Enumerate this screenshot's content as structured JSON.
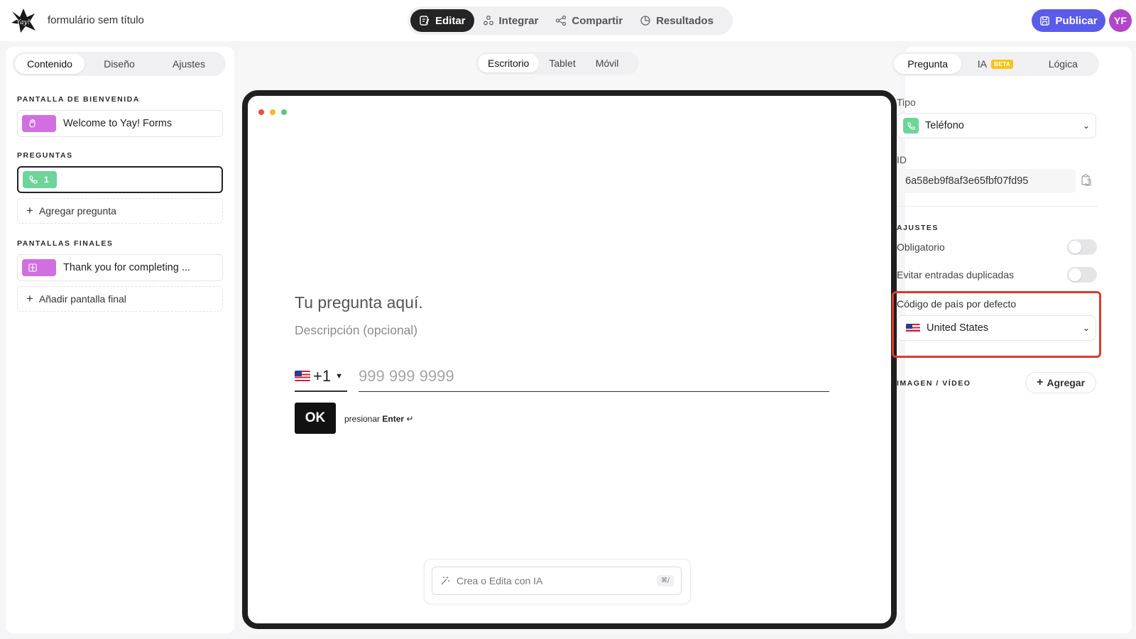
{
  "app": {
    "form_title": "formulário sem título",
    "avatar_initials": "YF",
    "publish_label": "Publicar",
    "accent_color": "#5b5bea"
  },
  "mode_tabs": [
    {
      "label": "Editar",
      "icon": "edit-icon",
      "active": true
    },
    {
      "label": "Integrar",
      "icon": "integrate-icon",
      "active": false
    },
    {
      "label": "Compartir",
      "icon": "share-icon",
      "active": false
    },
    {
      "label": "Resultados",
      "icon": "results-icon",
      "active": false
    }
  ],
  "left_panel": {
    "tabs": [
      "Contenido",
      "Diseño",
      "Ajustes"
    ],
    "active_tab": "Contenido",
    "welcome_section_label": "PANTALLA DE BIENVENIDA",
    "welcome_item": "Welcome to Yay! Forms",
    "questions_section_label": "PREGUNTAS",
    "question_item_number": "1",
    "add_question_label": "Agregar pregunta",
    "endings_section_label": "PANTALLAS FINALES",
    "ending_item": "Thank you for completing ...",
    "add_ending_label": "Añadir pantalla final"
  },
  "center_panel": {
    "device_tabs": [
      "Escritorio",
      "Tablet",
      "Móvil"
    ],
    "active_device": "Escritorio",
    "question_title": "Tu pregunta aquí.",
    "question_description": "Descripción (opcional)",
    "country_code": "+1",
    "phone_placeholder": "999 999 9999",
    "ok_label": "OK",
    "press_label": "presionar",
    "enter_label": "Enter",
    "ai_placeholder": "Crea o Edita con IA",
    "ai_shortcut": "⌘/"
  },
  "right_panel": {
    "tabs": [
      "Pregunta",
      "IA",
      "Lógica"
    ],
    "beta_label": "BETA",
    "active_tab": "Pregunta",
    "type_label": "Tipo",
    "type_value": "Teléfono",
    "id_label": "ID",
    "id_value": "6a58eb9f8af3e65fbf07fd95",
    "settings_label": "AJUSTES",
    "required_label": "Obligatorio",
    "required_on": false,
    "dedupe_label": "Evitar entradas duplicadas",
    "dedupe_on": false,
    "country_default_label": "Código de país por defecto",
    "country_default_value": "United States",
    "media_label": "IMAGEN / VÍDEO",
    "add_media_label": "Agregar"
  }
}
